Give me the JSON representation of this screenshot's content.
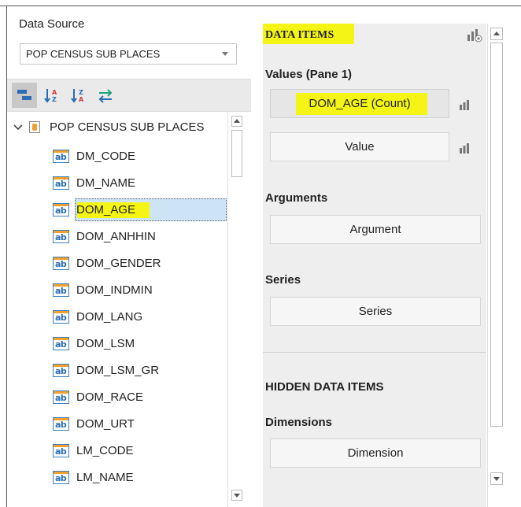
{
  "data_source": {
    "label": "Data Source",
    "selected": "POP CENSUS SUB PLACES"
  },
  "toolbar": {
    "icons": [
      "group-by-type-icon",
      "sort-ascending-icon",
      "sort-descending-icon",
      "refresh-fields-icon"
    ]
  },
  "tree": {
    "root_label": "POP CENSUS SUB PLACES",
    "field_icon_text": "ab",
    "items": [
      {
        "label": "DM_CODE"
      },
      {
        "label": "DM_NAME"
      },
      {
        "label": "DOM_AGE"
      },
      {
        "label": "DOM_ANHHIN"
      },
      {
        "label": "DOM_GENDER"
      },
      {
        "label": "DOM_INDMIN"
      },
      {
        "label": "DOM_LANG"
      },
      {
        "label": "DOM_LSM"
      },
      {
        "label": "DOM_LSM_GR"
      },
      {
        "label": "DOM_RACE"
      },
      {
        "label": "DOM_URT"
      },
      {
        "label": "LM_CODE"
      },
      {
        "label": "LM_NAME"
      }
    ],
    "selected_index": 2
  },
  "data_items": {
    "title": "DATA ITEMS",
    "values_section": "Values (Pane 1)",
    "value_slots": [
      "DOM_AGE (Count)",
      "Value"
    ],
    "arguments_section": "Arguments",
    "argument_slot": "Argument",
    "series_section": "Series",
    "series_slot": "Series",
    "hidden_title": "HIDDEN DATA ITEMS",
    "dimensions_section": "Dimensions",
    "dimension_slot": "Dimension"
  },
  "colors": {
    "highlight": "#f4f415",
    "selection": "#cde4f7",
    "accent_blue": "#2a6db5",
    "accent_orange": "#f0a030"
  }
}
